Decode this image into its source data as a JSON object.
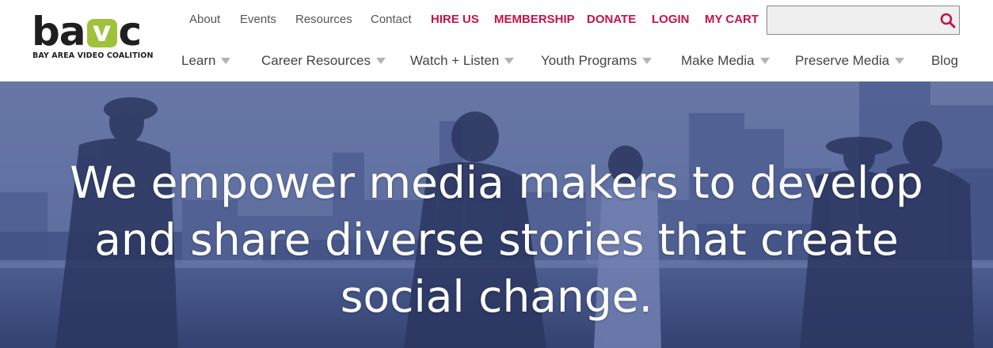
{
  "logo": {
    "letters_before": "ba",
    "letter_v": "v",
    "letters_after": "c",
    "tagline": "BAY AREA VIDEO COALITION",
    "accent_color": "#a0c13a"
  },
  "utility_nav": [
    {
      "label": "About"
    },
    {
      "label": "Events"
    },
    {
      "label": "Resources"
    },
    {
      "label": "Contact"
    },
    {
      "label": "HIRE US"
    },
    {
      "label": "MEMBERSHIP"
    },
    {
      "label": "DONATE"
    },
    {
      "label": "LOGIN"
    },
    {
      "label": "MY CART"
    }
  ],
  "search": {
    "value": "",
    "placeholder": "",
    "icon": "search-icon"
  },
  "main_nav": [
    {
      "label": "Learn",
      "has_dropdown": true
    },
    {
      "label": "Career Resources",
      "has_dropdown": true
    },
    {
      "label": "Watch + Listen",
      "has_dropdown": true
    },
    {
      "label": "Youth Programs",
      "has_dropdown": true
    },
    {
      "label": "Make Media",
      "has_dropdown": true
    },
    {
      "label": "Preserve Media",
      "has_dropdown": true
    },
    {
      "label": "Blog",
      "has_dropdown": false
    }
  ],
  "hero": {
    "line1": "We empower media makers to develop",
    "line2": "and share diverse stories that create",
    "line3": "social change."
  },
  "colors": {
    "accent": "#c5134b",
    "brand_green": "#a0c13a",
    "hero_tint": "#4a5d8f",
    "nav_text": "#444444"
  }
}
